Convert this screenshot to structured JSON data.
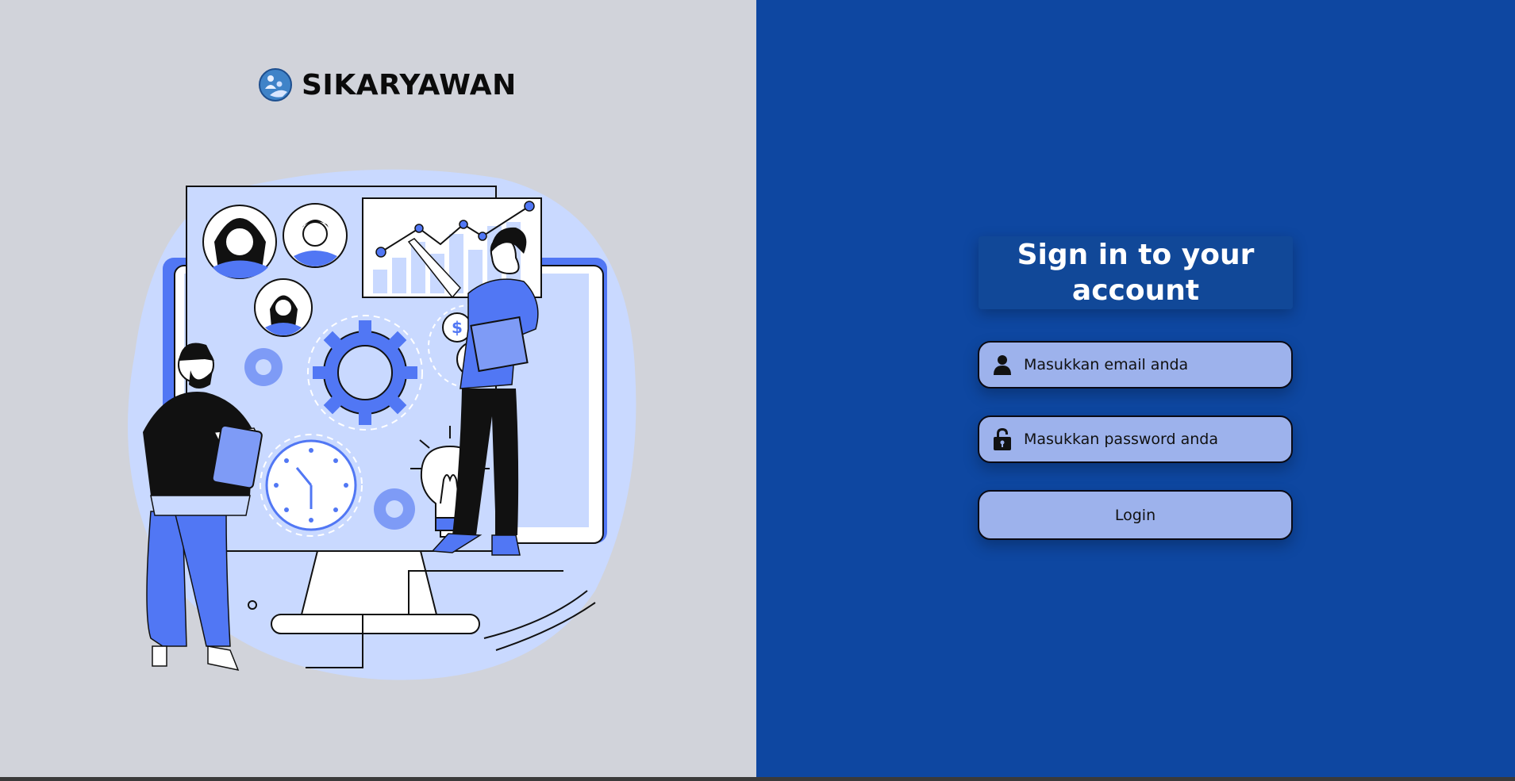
{
  "brand": {
    "name": "SIKARYAWAN"
  },
  "login": {
    "title": "Sign in to your account",
    "email_placeholder": "Masukkan email anda",
    "password_placeholder": "Masukkan password anda",
    "button_label": "Login"
  },
  "icons": {
    "logo": "people-globe-logo",
    "user": "user-icon",
    "lock": "lock-icon"
  },
  "colors": {
    "left_panel": "#d1d3da",
    "right_panel": "#0e47a1",
    "field_bg": "#9db2ec",
    "illustration_accent": "#5177f4"
  }
}
